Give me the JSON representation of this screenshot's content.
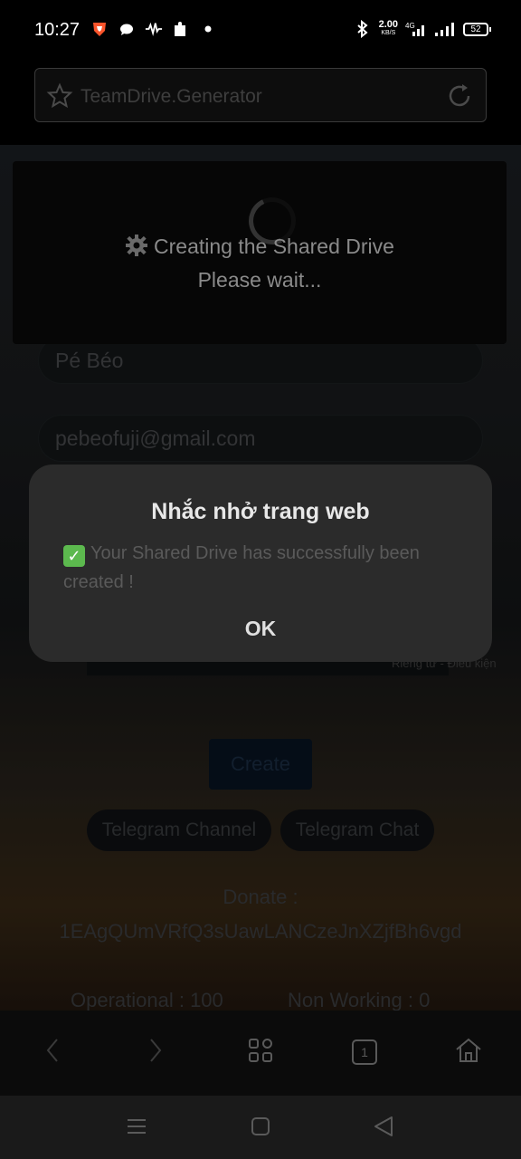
{
  "status_bar": {
    "time": "10:27",
    "net_speed_value": "2.00",
    "net_speed_unit": "KB/S",
    "network_type": "4G",
    "battery": "52"
  },
  "url_bar": {
    "text": "TeamDrive.Generator"
  },
  "loading": {
    "line1": "Creating the Shared Drive",
    "line2": "Please wait..."
  },
  "form": {
    "name_value": "Pé Béo",
    "email_value": "pebeofuji@gmail.com",
    "privacy_text": "Riêng tư - Điều kiện",
    "create_label": "Create",
    "telegram_channel": "Telegram Channel",
    "telegram_chat": "Telegram Chat",
    "donate_label": "Donate :",
    "donate_address": "1EAgQUmVRfQ3sUawLANCzeJnXZjfBh6vgd",
    "operational": "Operational : 100",
    "non_working": "Non Working : 0"
  },
  "dialog": {
    "title": "Nhắc nhở trang web",
    "message": "Your Shared Drive has successfully been created !",
    "ok_label": "OK"
  },
  "browser_nav": {
    "tab_count": "1"
  },
  "colors": {
    "dialog_bg": "#2b2b2b",
    "check_green": "#5cb94e",
    "create_btn": "#081424"
  }
}
